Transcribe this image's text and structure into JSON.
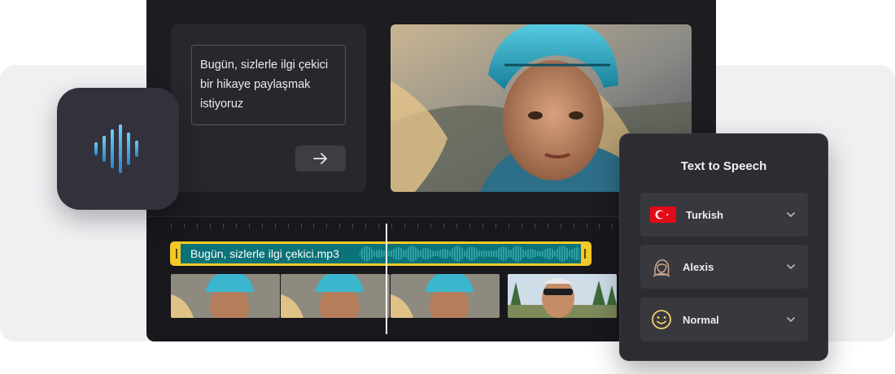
{
  "text_input": {
    "lines": [
      "Bugün, sizlerle ilgi çekici",
      "bir hikaye paylaşmak",
      "istiyoruz"
    ],
    "send_icon": "arrow-right-icon"
  },
  "timeline": {
    "audio_clip_name": "Bugün, sizlerle ilgi çekici.mp3"
  },
  "panel": {
    "title": "Text to Speech",
    "language": "Turkish",
    "voice": "Alexis",
    "style": "Normal",
    "icons": [
      "turkey-flag-icon",
      "avatar-icon",
      "smiley-icon",
      "chevron-down-icon"
    ]
  },
  "colors": {
    "accent_yellow": "#f3c928",
    "clip_teal": "#0b7277",
    "waveform_blue": "#4fb7e6"
  }
}
